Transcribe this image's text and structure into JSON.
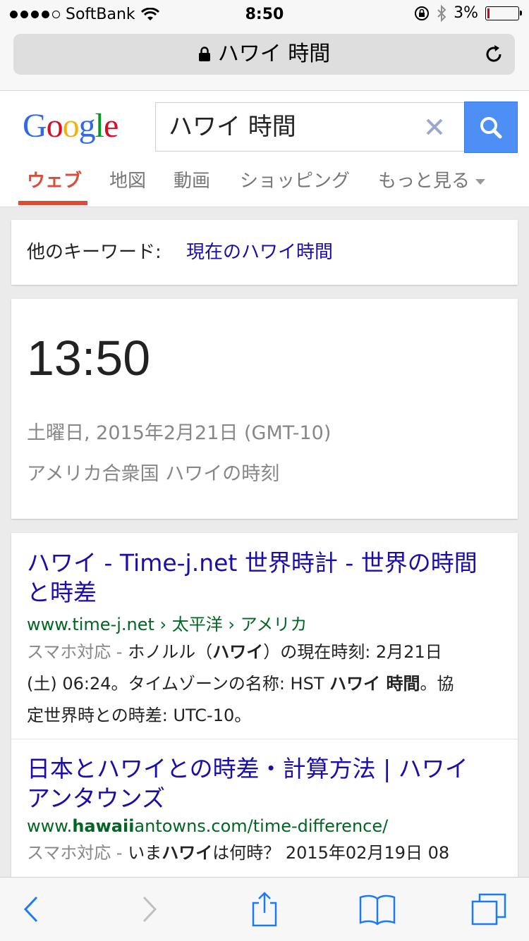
{
  "status_bar": {
    "carrier": "SoftBank",
    "time": "8:50",
    "battery": "3%",
    "battery_level": 0.03,
    "signal_bars": 4,
    "signal_max": 5
  },
  "url_bar": {
    "text": "ハワイ 時間",
    "icons": [
      "lock-icon",
      "reload-icon"
    ]
  },
  "google": {
    "logo": "Google",
    "search_value": "ハワイ 時間",
    "tabs": [
      {
        "label": "ウェブ",
        "active": true
      },
      {
        "label": "地図"
      },
      {
        "label": "動画"
      },
      {
        "label": "ショッピング"
      },
      {
        "label": "もっと見る"
      }
    ]
  },
  "related": {
    "label": "他のキーワード:",
    "link": "現在のハワイ時間"
  },
  "time_card": {
    "time": "13:50",
    "date": "土曜日, 2015年2月21日 (GMT-10)",
    "place": "アメリカ合衆国 ハワイの時刻"
  },
  "results": [
    {
      "title_1": "ハワイ - Time-j.net 世界時計 - 世界の時間",
      "title_2": "と時差",
      "url_a": "www.time-j.net",
      "url_sep1": " › ",
      "url_b": "太平洋",
      "url_sep2": " › ",
      "url_c": "アメリカ",
      "snippet_prefix": "スマホ対応 - ",
      "s1": "ホノルル（",
      "s1b": "ハワイ",
      "s1c": "）の現在時刻: 2月21日",
      "s2": "(土) 06:24。タイムゾーンの名称: HST ",
      "s2b": "ハワイ 時間",
      "s2c": "。協",
      "s3": "定世界時との時差: UTC-10。"
    },
    {
      "title_1": "日本とハワイとの時差・計算方法 | ハワイ",
      "title_2": "アンタウンズ",
      "url_a": "www.",
      "url_b": "hawaii",
      "url_c": "antowns.com/time-difference/",
      "snippet_prefix": "スマホ対応 - ",
      "s1": "いま",
      "s1b": "ハワイ",
      "s1c": "は何時？ 2015年02月19日 08"
    }
  ],
  "toolbar": [
    "back-icon",
    "forward-icon",
    "share-icon",
    "bookmarks-icon",
    "tabs-icon"
  ],
  "colors": {
    "accent_red": "#dd4b39",
    "link_blue": "#1a0dab",
    "url_green": "#006621",
    "search_blue": "#4d8ff5",
    "ios_blue": "#1a7cf5"
  }
}
